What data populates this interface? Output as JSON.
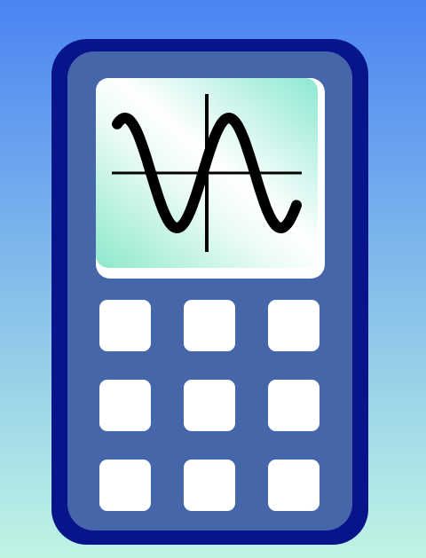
{
  "colors": {
    "background_top": "#4a84f2",
    "background_bottom": "#bff5e4",
    "calculator_outer": "#08148a",
    "calculator_face": "#4567aa",
    "screen_gradient": [
      "#8ce8cc",
      "#eafbf5",
      "#ffffff",
      "#8ce8d2"
    ],
    "screen_bezel": "#ffffff",
    "graph_stroke": "#000000",
    "key_fill": "#ffffff"
  },
  "screen": {
    "icon": "sine-wave-icon"
  },
  "keypad": {
    "rows": 3,
    "columns": 3
  }
}
